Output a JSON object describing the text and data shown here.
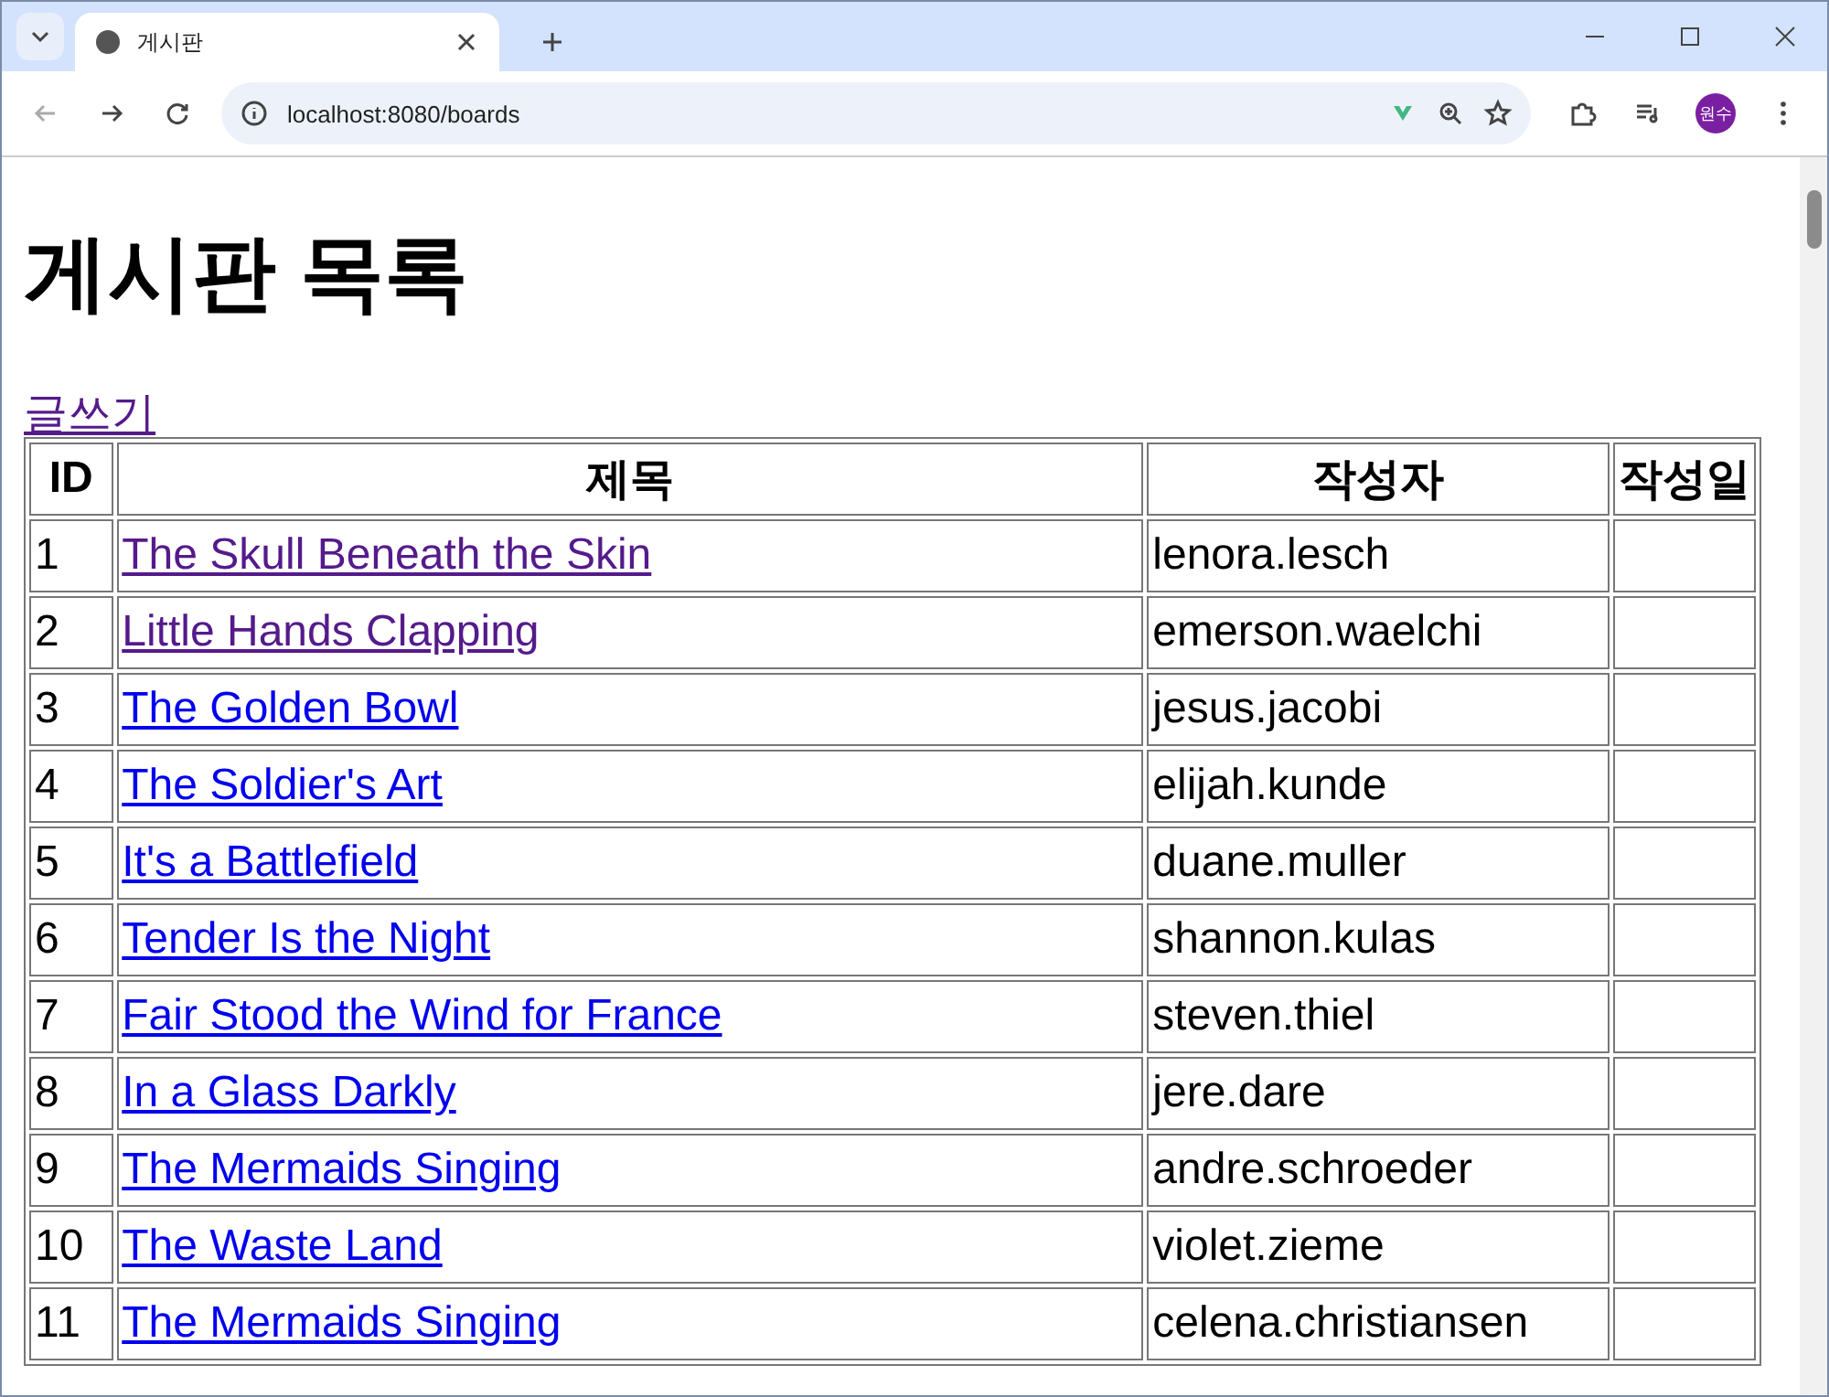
{
  "browser": {
    "tab_title": "게시판",
    "url": "localhost:8080/boards",
    "profile": "원수"
  },
  "page": {
    "heading": "게시판 목록",
    "write_link": "글쓰기"
  },
  "table": {
    "columns": [
      "ID",
      "제목",
      "작성자",
      "작성일"
    ],
    "rows": [
      {
        "id": "1",
        "title": "The Skull Beneath the Skin",
        "author": "lenora.lesch",
        "visited": true
      },
      {
        "id": "2",
        "title": "Little Hands Clapping",
        "author": "emerson.waelchi",
        "visited": true
      },
      {
        "id": "3",
        "title": "The Golden Bowl",
        "author": "jesus.jacobi",
        "visited": false
      },
      {
        "id": "4",
        "title": "The Soldier's Art",
        "author": "elijah.kunde",
        "visited": false
      },
      {
        "id": "5",
        "title": "It's a Battlefield",
        "author": "duane.muller",
        "visited": false
      },
      {
        "id": "6",
        "title": "Tender Is the Night",
        "author": "shannon.kulas",
        "visited": false
      },
      {
        "id": "7",
        "title": "Fair Stood the Wind for France",
        "author": "steven.thiel",
        "visited": false
      },
      {
        "id": "8",
        "title": "In a Glass Darkly",
        "author": "jere.dare",
        "visited": false
      },
      {
        "id": "9",
        "title": "The Mermaids Singing",
        "author": "andre.schroeder",
        "visited": false
      },
      {
        "id": "10",
        "title": "The Waste Land",
        "author": "violet.zieme",
        "visited": false
      },
      {
        "id": "11",
        "title": "The Mermaids Singing",
        "author": "celena.christiansen",
        "visited": false
      }
    ]
  }
}
